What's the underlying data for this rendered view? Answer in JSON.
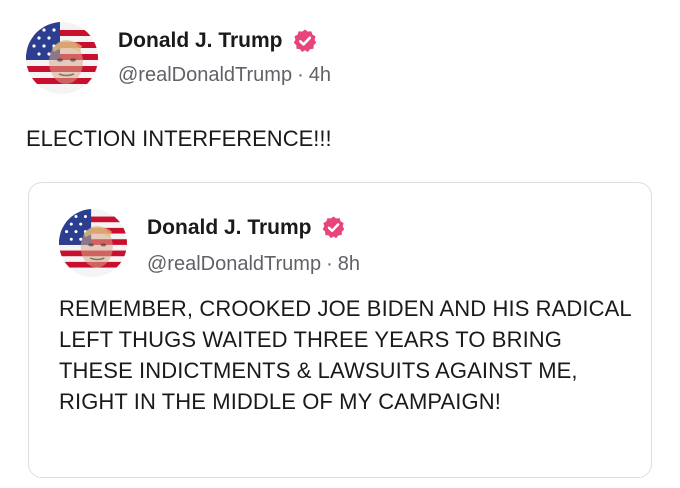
{
  "post": {
    "author_name": "Donald J. Trump",
    "handle": "@realDonaldTrump",
    "separator": "·",
    "time": "4h",
    "text": "ELECTION INTERFERENCE!!!"
  },
  "quoted_post": {
    "author_name": "Donald J. Trump",
    "handle": "@realDonaldTrump",
    "separator": "·",
    "time": "8h",
    "text": "REMEMBER, CROOKED JOE BIDEN AND HIS RADICAL LEFT THUGS WAITED THREE YEARS TO BRING THESE INDICTMENTS & LAWSUITS AGAINST ME, RIGHT IN THE MIDDLE OF MY CAMPAIGN!"
  },
  "colors": {
    "verified_badge": "#e8447c",
    "handle_text": "#5f6266",
    "card_border": "#dedede"
  },
  "icons": {
    "verified": "verified-badge-icon",
    "avatar": "flag-portrait-avatar"
  }
}
